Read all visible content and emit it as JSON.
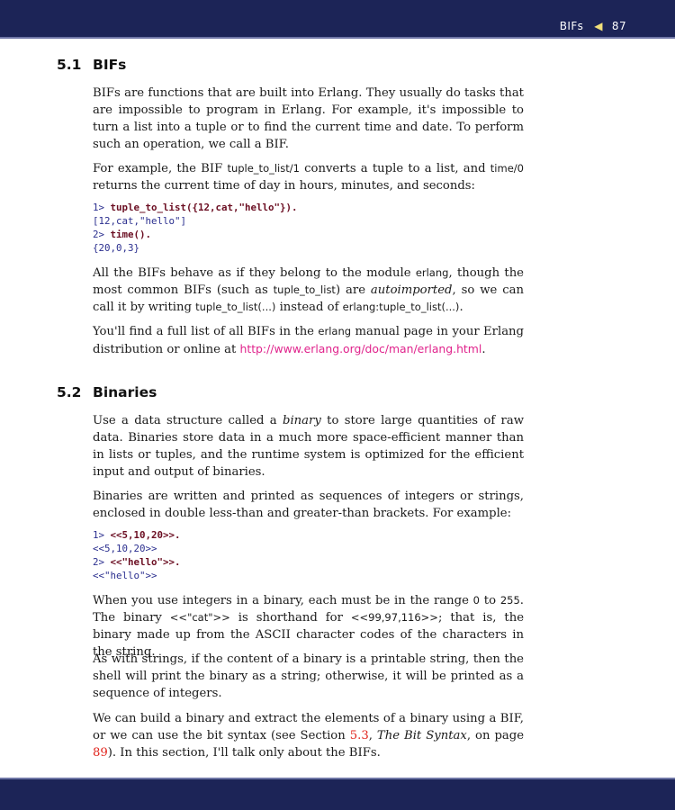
{
  "header": {
    "section": "BIFs",
    "page": "87"
  },
  "s51": {
    "number": "5.1",
    "title": "BIFs"
  },
  "p1": "BIFs are functions that are built into Erlang. They usually do tasks that are impossible to program in Erlang. For example, it's impossible to turn a list into a tuple or to find the current time and date. To perform such an operation, we call a BIF.",
  "p2": {
    "t1": "For example, the BIF ",
    "c1": "tuple_to_list/1",
    "t2": " converts a tuple to a list, and ",
    "c2": "time/0",
    "t3": " returns the current time of day in hours, minutes, and seconds:"
  },
  "code1": [
    {
      "prompt": "1> ",
      "cmd": "tuple_to_list({12,cat,\"hello\"})."
    },
    {
      "out": "[12,cat,\"hello\"]"
    },
    {
      "prompt": "2> ",
      "cmd": "time()."
    },
    {
      "out": "{20,0,3}"
    }
  ],
  "p3": {
    "t1": "All the BIFs behave as if they belong to the module ",
    "c1": "erlang",
    "t2": ", though the most common BIFs (such as ",
    "c2": "tuple_to_list",
    "t3": ") are ",
    "em": "autoimported",
    "t4": ", so we can call it by writing ",
    "c3": "tuple_to_list(...)",
    "t5": " instead of ",
    "c4": "erlang:tuple_to_list(...)",
    "t6": "."
  },
  "p4": {
    "t1": "You'll find a full list of all BIFs in the ",
    "c1": "erlang",
    "t2": " manual page in your Erlang distribution or online at ",
    "link": "http://www.erlang.org/doc/man/erlang.html",
    "t3": "."
  },
  "s52": {
    "number": "5.2",
    "title": "Binaries"
  },
  "p5": {
    "t1": "Use a data structure called a ",
    "em": "binary",
    "t2": " to store large quantities of raw data. Binaries store data in a much more space-efficient manner than in lists or tuples, and the runtime system is optimized for the efficient input and output of binaries."
  },
  "p6": "Binaries are written and printed as sequences of integers or strings, enclosed in double less-than and greater-than brackets. For example:",
  "code2": [
    {
      "prompt": "1> ",
      "cmd": "<<5,10,20>>."
    },
    {
      "out": "<<5,10,20>>"
    },
    {
      "prompt": "2> ",
      "cmd": "<<\"hello\">>."
    },
    {
      "out": "<<\"hello\">>"
    }
  ],
  "p7": {
    "t1": "When you use integers in a binary, each must be in the range ",
    "c1": "0",
    "t2": " to ",
    "c2": "255",
    "t3": ". The binary ",
    "c3": "<<\"cat\">>",
    "t4": " is shorthand for ",
    "c4": "<<99,97,116>>",
    "t5": "; that is, the binary made up from the ASCII character codes of the characters in the string."
  },
  "p8": "As with strings, if the content of a binary is a printable string, then the shell will print the binary as a string; otherwise, it will be printed as a sequence of integers.",
  "p9": {
    "t1": "We can build a binary and extract the elements of a binary using a BIF, or we can use the bit syntax (see Section ",
    "ref1": "5.3",
    "t2": ", ",
    "em": "The Bit Syntax",
    "t3": ", on page ",
    "ref2": "89",
    "t4": "). In this section, I'll talk only about the BIFs."
  }
}
